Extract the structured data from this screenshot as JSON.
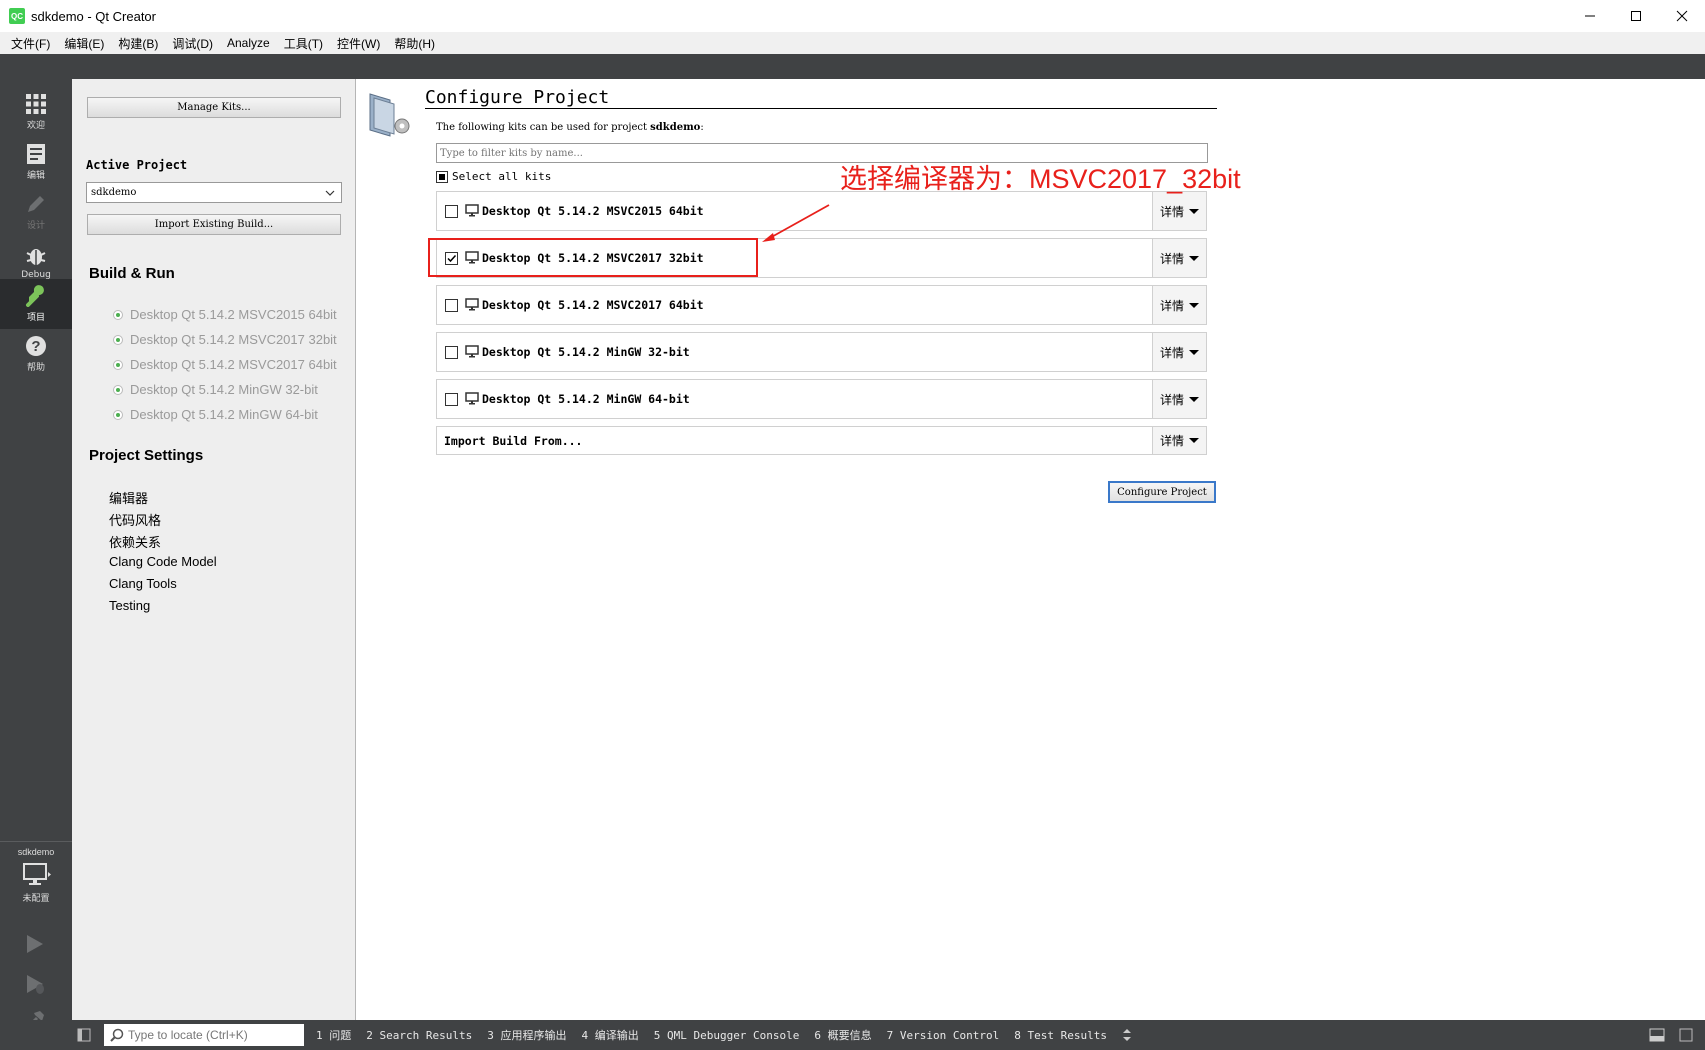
{
  "window": {
    "title": "sdkdemo - Qt Creator",
    "logo_text": "QC"
  },
  "menu": [
    "文件(F)",
    "编辑(E)",
    "构建(B)",
    "调试(D)",
    "Analyze",
    "工具(T)",
    "控件(W)",
    "帮助(H)"
  ],
  "modes": {
    "welcome": "欢迎",
    "edit": "编辑",
    "design": "设计",
    "debug": "Debug",
    "projects": "项目",
    "help": "帮助"
  },
  "target": {
    "project_name": "sdkdemo",
    "status": "未配置"
  },
  "sidebar": {
    "manage_kits": "Manage Kits...",
    "active_project_heading": "Active Project",
    "active_project_value": "sdkdemo",
    "import_existing": "Import Existing Build...",
    "build_run_heading": "Build & Run",
    "build_run_items": [
      "Desktop Qt 5.14.2 MSVC2015 64bit",
      "Desktop Qt 5.14.2 MSVC2017 32bit",
      "Desktop Qt 5.14.2 MSVC2017 64bit",
      "Desktop Qt 5.14.2 MinGW 32-bit",
      "Desktop Qt 5.14.2 MinGW 64-bit"
    ],
    "project_settings_heading": "Project Settings",
    "project_settings_items": [
      "编辑器",
      "代码风格",
      "依赖关系",
      "Clang Code Model",
      "Clang Tools",
      "Testing"
    ]
  },
  "configure": {
    "title": "Configure Project",
    "description_prefix": "The following kits can be used for project ",
    "description_project": "sdkdemo",
    "description_suffix": ":",
    "filter_placeholder": "Type to filter kits by name...",
    "select_all": "Select all kits",
    "details_label": "详情",
    "kits": [
      {
        "name": "Desktop Qt 5.14.2 MSVC2015 64bit",
        "checked": false
      },
      {
        "name": "Desktop Qt 5.14.2 MSVC2017 32bit",
        "checked": true
      },
      {
        "name": "Desktop Qt 5.14.2 MSVC2017 64bit",
        "checked": false
      },
      {
        "name": "Desktop Qt 5.14.2 MinGW 32-bit",
        "checked": false
      },
      {
        "name": "Desktop Qt 5.14.2 MinGW 64-bit",
        "checked": false
      }
    ],
    "import_build_from": "Import Build From...",
    "configure_button": "Configure Project"
  },
  "annotation": {
    "text": "选择编译器为：MSVC2017_32bit",
    "color": "#e8201b"
  },
  "statusbar": {
    "locator_placeholder": "Type to locate (Ctrl+K)",
    "panes": [
      "1 问题",
      "2 Search Results",
      "3 应用程序输出",
      "4 编译输出",
      "5 QML Debugger Console",
      "6 概要信息",
      "7 Version Control",
      "8 Test Results"
    ]
  }
}
